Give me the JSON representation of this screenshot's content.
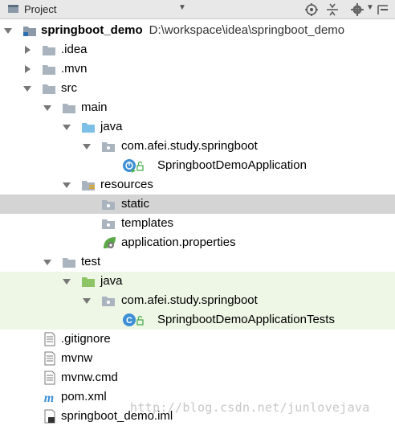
{
  "toolbar": {
    "title": "Project",
    "icons": [
      "project-icon",
      "dropdown-icon",
      "target-icon",
      "collapse-icon",
      "gear-icon",
      "hide-icon"
    ]
  },
  "tree": {
    "root": {
      "name": "springboot_demo",
      "path": "D:\\workspace\\idea\\springboot_demo"
    },
    "idea": ".idea",
    "mvn": ".mvn",
    "src": "src",
    "main": "main",
    "main_java": "java",
    "main_pkg": "com.afei.study.springboot",
    "app_class": "SpringbootDemoApplication",
    "resources": "resources",
    "static": "static",
    "templates": "templates",
    "app_props": "application.properties",
    "test": "test",
    "test_java": "java",
    "test_pkg": "com.afei.study.springboot",
    "test_class": "SpringbootDemoApplicationTests",
    "gitignore": ".gitignore",
    "mvnw": "mvnw",
    "mvnw_cmd": "mvnw.cmd",
    "pom": "pom.xml",
    "iml": "springboot_demo.iml"
  },
  "watermark": "http://blog.csdn.net/junlovejava",
  "colors": {
    "selected_row": "#d4d4d4",
    "test_row": "#eef7e6",
    "folder_gray": "#a9b4be",
    "folder_blue": "#7cc0e8",
    "folder_green": "#8cc466",
    "class_blue": "#3d8fd6"
  }
}
